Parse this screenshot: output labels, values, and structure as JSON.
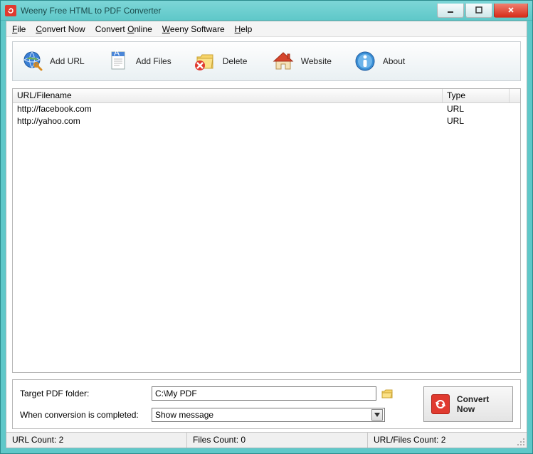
{
  "title": "Weeny Free HTML to PDF Converter",
  "menu": {
    "file": "File",
    "convert_now": "Convert Now",
    "convert_online": "Convert Online",
    "weeny_software": "Weeny Software",
    "help": "Help"
  },
  "toolbar": {
    "add_url": "Add URL",
    "add_files": "Add Files",
    "delete": "Delete",
    "website": "Website",
    "about": "About"
  },
  "list": {
    "headers": {
      "url": "URL/Filename",
      "type": "Type"
    },
    "rows": [
      {
        "url": "http://facebook.com",
        "type": "URL"
      },
      {
        "url": "http://yahoo.com",
        "type": "URL"
      }
    ]
  },
  "options": {
    "target_label": "Target PDF folder:",
    "target_value": "C:\\My PDF",
    "completion_label": "When conversion is completed:",
    "completion_value": "Show message",
    "convert_label": "Convert Now"
  },
  "status": {
    "url_count": "URL Count: 2",
    "files_count": "Files Count: 0",
    "total_count": "URL/Files Count: 2"
  }
}
